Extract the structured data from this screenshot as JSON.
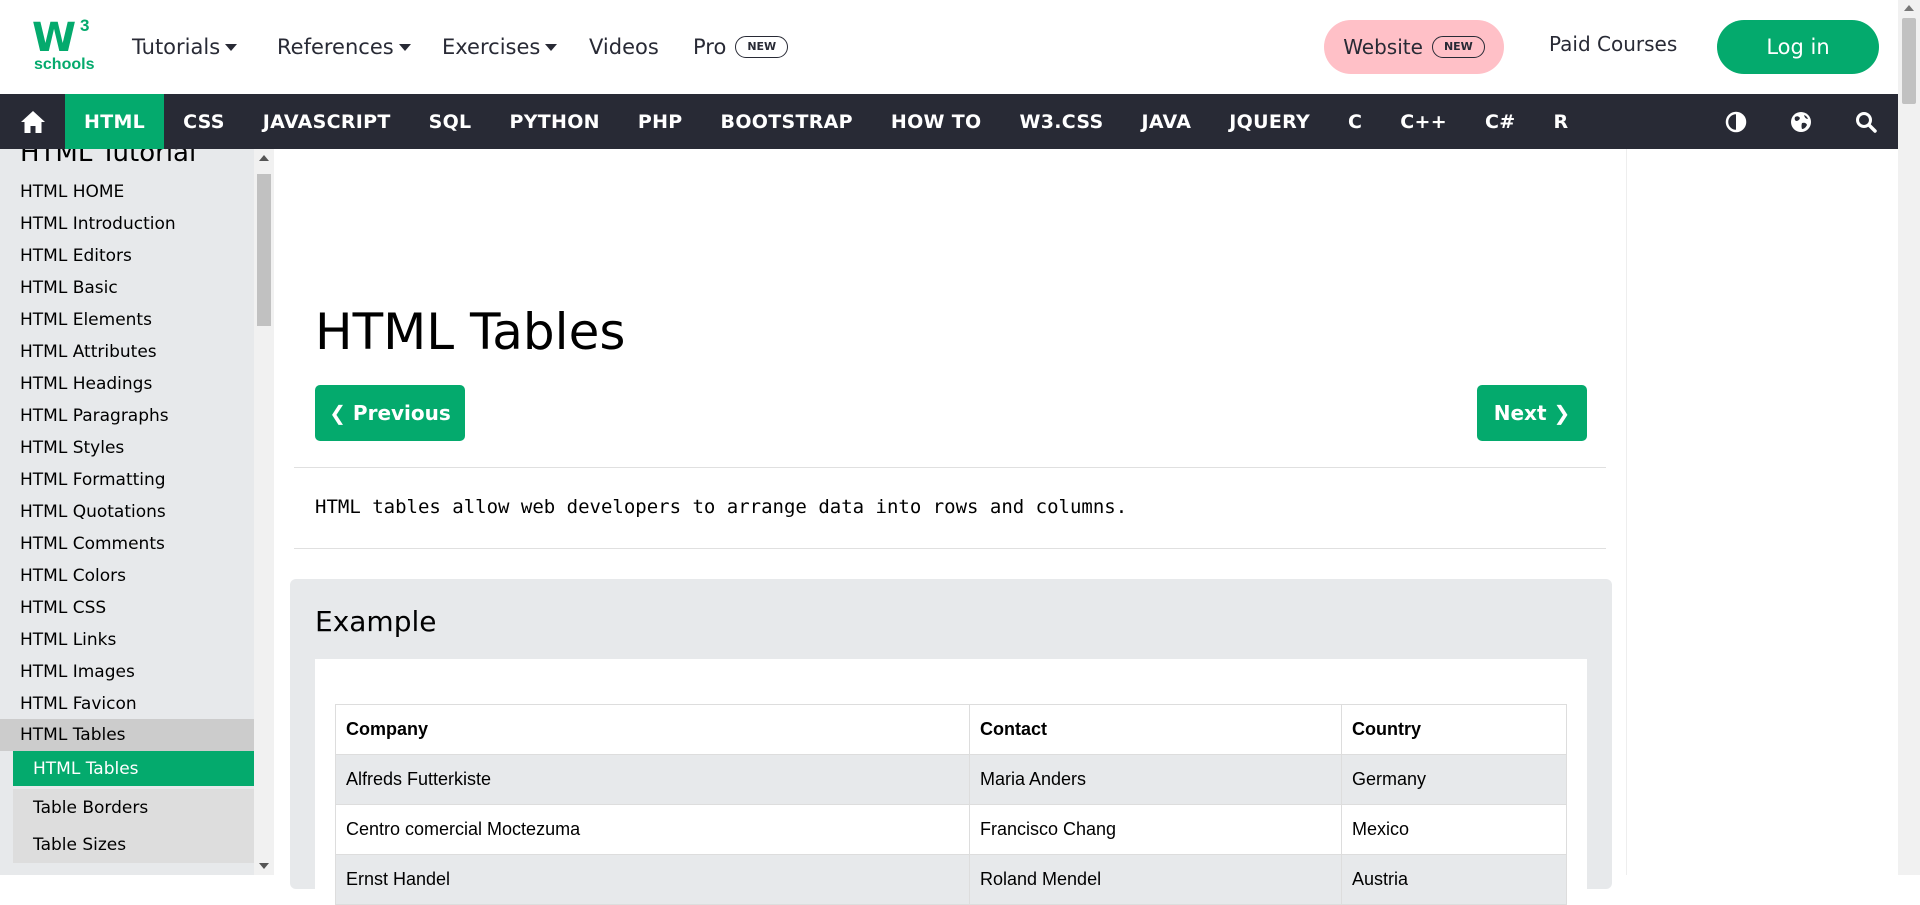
{
  "brand": {
    "logo_mark": "W",
    "logo_super": "3",
    "logo_word": "schools",
    "color": "#04AA6D"
  },
  "topnav": {
    "items": [
      {
        "label": "Tutorials",
        "has_caret": true
      },
      {
        "label": "References",
        "has_caret": true
      },
      {
        "label": "Exercises",
        "has_caret": true
      },
      {
        "label": "Videos",
        "has_caret": false
      },
      {
        "label": "Pro",
        "badge": "NEW"
      }
    ],
    "website_label": "Website",
    "website_badge": "NEW",
    "paid_courses": "Paid Courses",
    "login": "Log in"
  },
  "subnav": {
    "home_icon": "home-icon",
    "links": [
      "HTML",
      "CSS",
      "JAVASCRIPT",
      "SQL",
      "PYTHON",
      "PHP",
      "BOOTSTRAP",
      "HOW TO",
      "W3.CSS",
      "JAVA",
      "JQUERY",
      "C",
      "C++",
      "C#",
      "R"
    ],
    "active": "HTML",
    "icons": [
      "contrast-icon",
      "globe-icon",
      "search-icon"
    ]
  },
  "sidebar": {
    "title": "HTML Tutorial",
    "items": [
      "HTML HOME",
      "HTML Introduction",
      "HTML Editors",
      "HTML Basic",
      "HTML Elements",
      "HTML Attributes",
      "HTML Headings",
      "HTML Paragraphs",
      "HTML Styles",
      "HTML Formatting",
      "HTML Quotations",
      "HTML Comments",
      "HTML Colors",
      "HTML CSS",
      "HTML Links",
      "HTML Images",
      "HTML Favicon",
      "HTML Tables"
    ],
    "current": "HTML Tables",
    "subitems": [
      "HTML Tables",
      "Table Borders",
      "Table Sizes"
    ],
    "active_sub": "HTML Tables"
  },
  "main": {
    "title": "HTML Tables",
    "prev": "❮ Previous",
    "next": "Next ❯",
    "intro": "HTML tables allow web developers to arrange data into rows and columns.",
    "example_title": "Example",
    "table": {
      "headers": [
        "Company",
        "Contact",
        "Country"
      ],
      "rows": [
        [
          "Alfreds Futterkiste",
          "Maria Anders",
          "Germany"
        ],
        [
          "Centro comercial Moctezuma",
          "Francisco Chang",
          "Mexico"
        ],
        [
          "Ernst Handel",
          "Roland Mendel",
          "Austria"
        ]
      ]
    }
  }
}
